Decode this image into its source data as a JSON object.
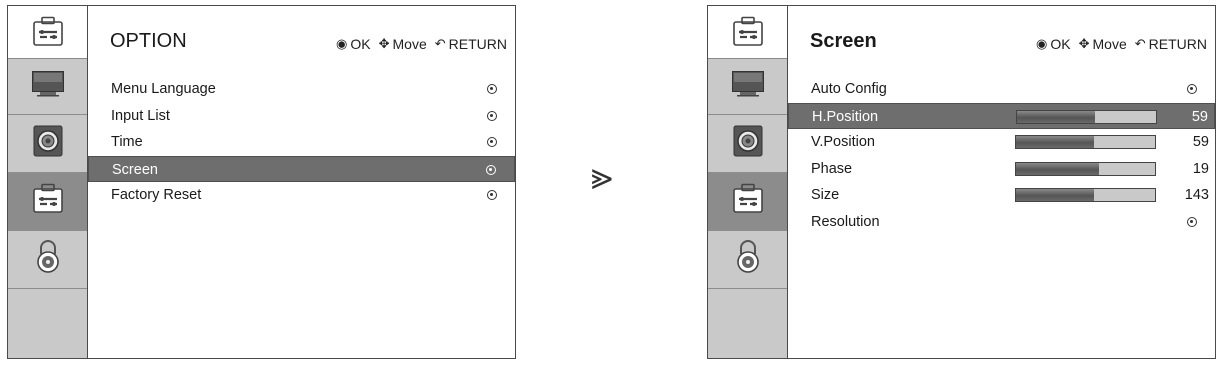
{
  "arrow_symbol": "⪢",
  "hints": {
    "ok_symbol": "◉",
    "ok_label": "OK",
    "move_symbol": "✥",
    "move_label": "Move",
    "return_symbol": "↶",
    "return_label": "RETURN"
  },
  "sidebar_icons": [
    "tools-icon",
    "monitor-icon",
    "speaker-icon",
    "tools-icon",
    "lock-icon"
  ],
  "left_panel": {
    "title": "OPTION",
    "selected_category": "option",
    "items": [
      {
        "label": "Menu Language"
      },
      {
        "label": "Input List"
      },
      {
        "label": "Time"
      },
      {
        "label": "Screen",
        "selected": true
      },
      {
        "label": "Factory Reset"
      }
    ]
  },
  "right_panel": {
    "title": "Screen",
    "selected_category": "option",
    "items": [
      {
        "label": "Auto Config",
        "type": "action"
      },
      {
        "label": "H.Position",
        "type": "slider",
        "value": "59",
        "fill_fraction": 0.56,
        "selected": true
      },
      {
        "label": "V.Position",
        "type": "slider",
        "value": "59",
        "fill_fraction": 0.56
      },
      {
        "label": "Phase",
        "type": "slider",
        "value": "19",
        "fill_fraction": 0.6
      },
      {
        "label": "Size",
        "type": "slider",
        "value": "143",
        "fill_fraction": 0.56
      },
      {
        "label": "Resolution",
        "type": "action"
      }
    ]
  },
  "colors": {
    "selected_row": "#6e6e6e",
    "sidebar": "#c9c9c9",
    "sidebar_selected": "#8c8c8c",
    "bar_fill": "#555555"
  }
}
